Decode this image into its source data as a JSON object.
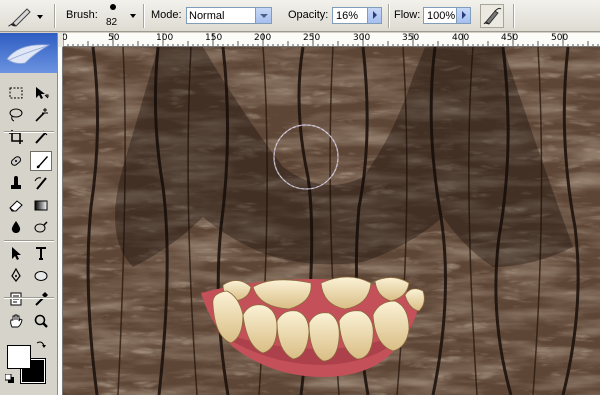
{
  "options_bar": {
    "brush_label": "Brush:",
    "brush_size": "82",
    "mode_label": "Mode:",
    "mode_value": "Normal",
    "opacity_label": "Opacity:",
    "opacity_value": "16%",
    "flow_label": "Flow:",
    "flow_value": "100%"
  },
  "ruler": {
    "labels": [
      "0",
      "50",
      "100",
      "150",
      "200",
      "250",
      "300",
      "350",
      "400",
      "450",
      "500"
    ]
  },
  "toolbox": {
    "tools": [
      "marquee-tool",
      "move-tool",
      "lasso-tool",
      "magic-wand-tool",
      "crop-tool",
      "slice-tool",
      "healing-brush-tool",
      "brush-tool",
      "clone-stamp-tool",
      "history-brush-tool",
      "eraser-tool",
      "gradient-tool",
      "blur-tool",
      "dodge-tool",
      "path-selection-tool",
      "type-tool",
      "pen-tool",
      "shape-tool",
      "notes-tool",
      "eyedropper-tool",
      "hand-tool",
      "zoom-tool"
    ],
    "active_tool": "brush-tool",
    "foreground_color": "#ffffff",
    "background_color": "#000000"
  },
  "colors": {
    "toolbox_header": "#2e5dc2",
    "canvas_bark": "#5a4434",
    "gums": "#c4515a",
    "teeth": "#f2dfae"
  }
}
